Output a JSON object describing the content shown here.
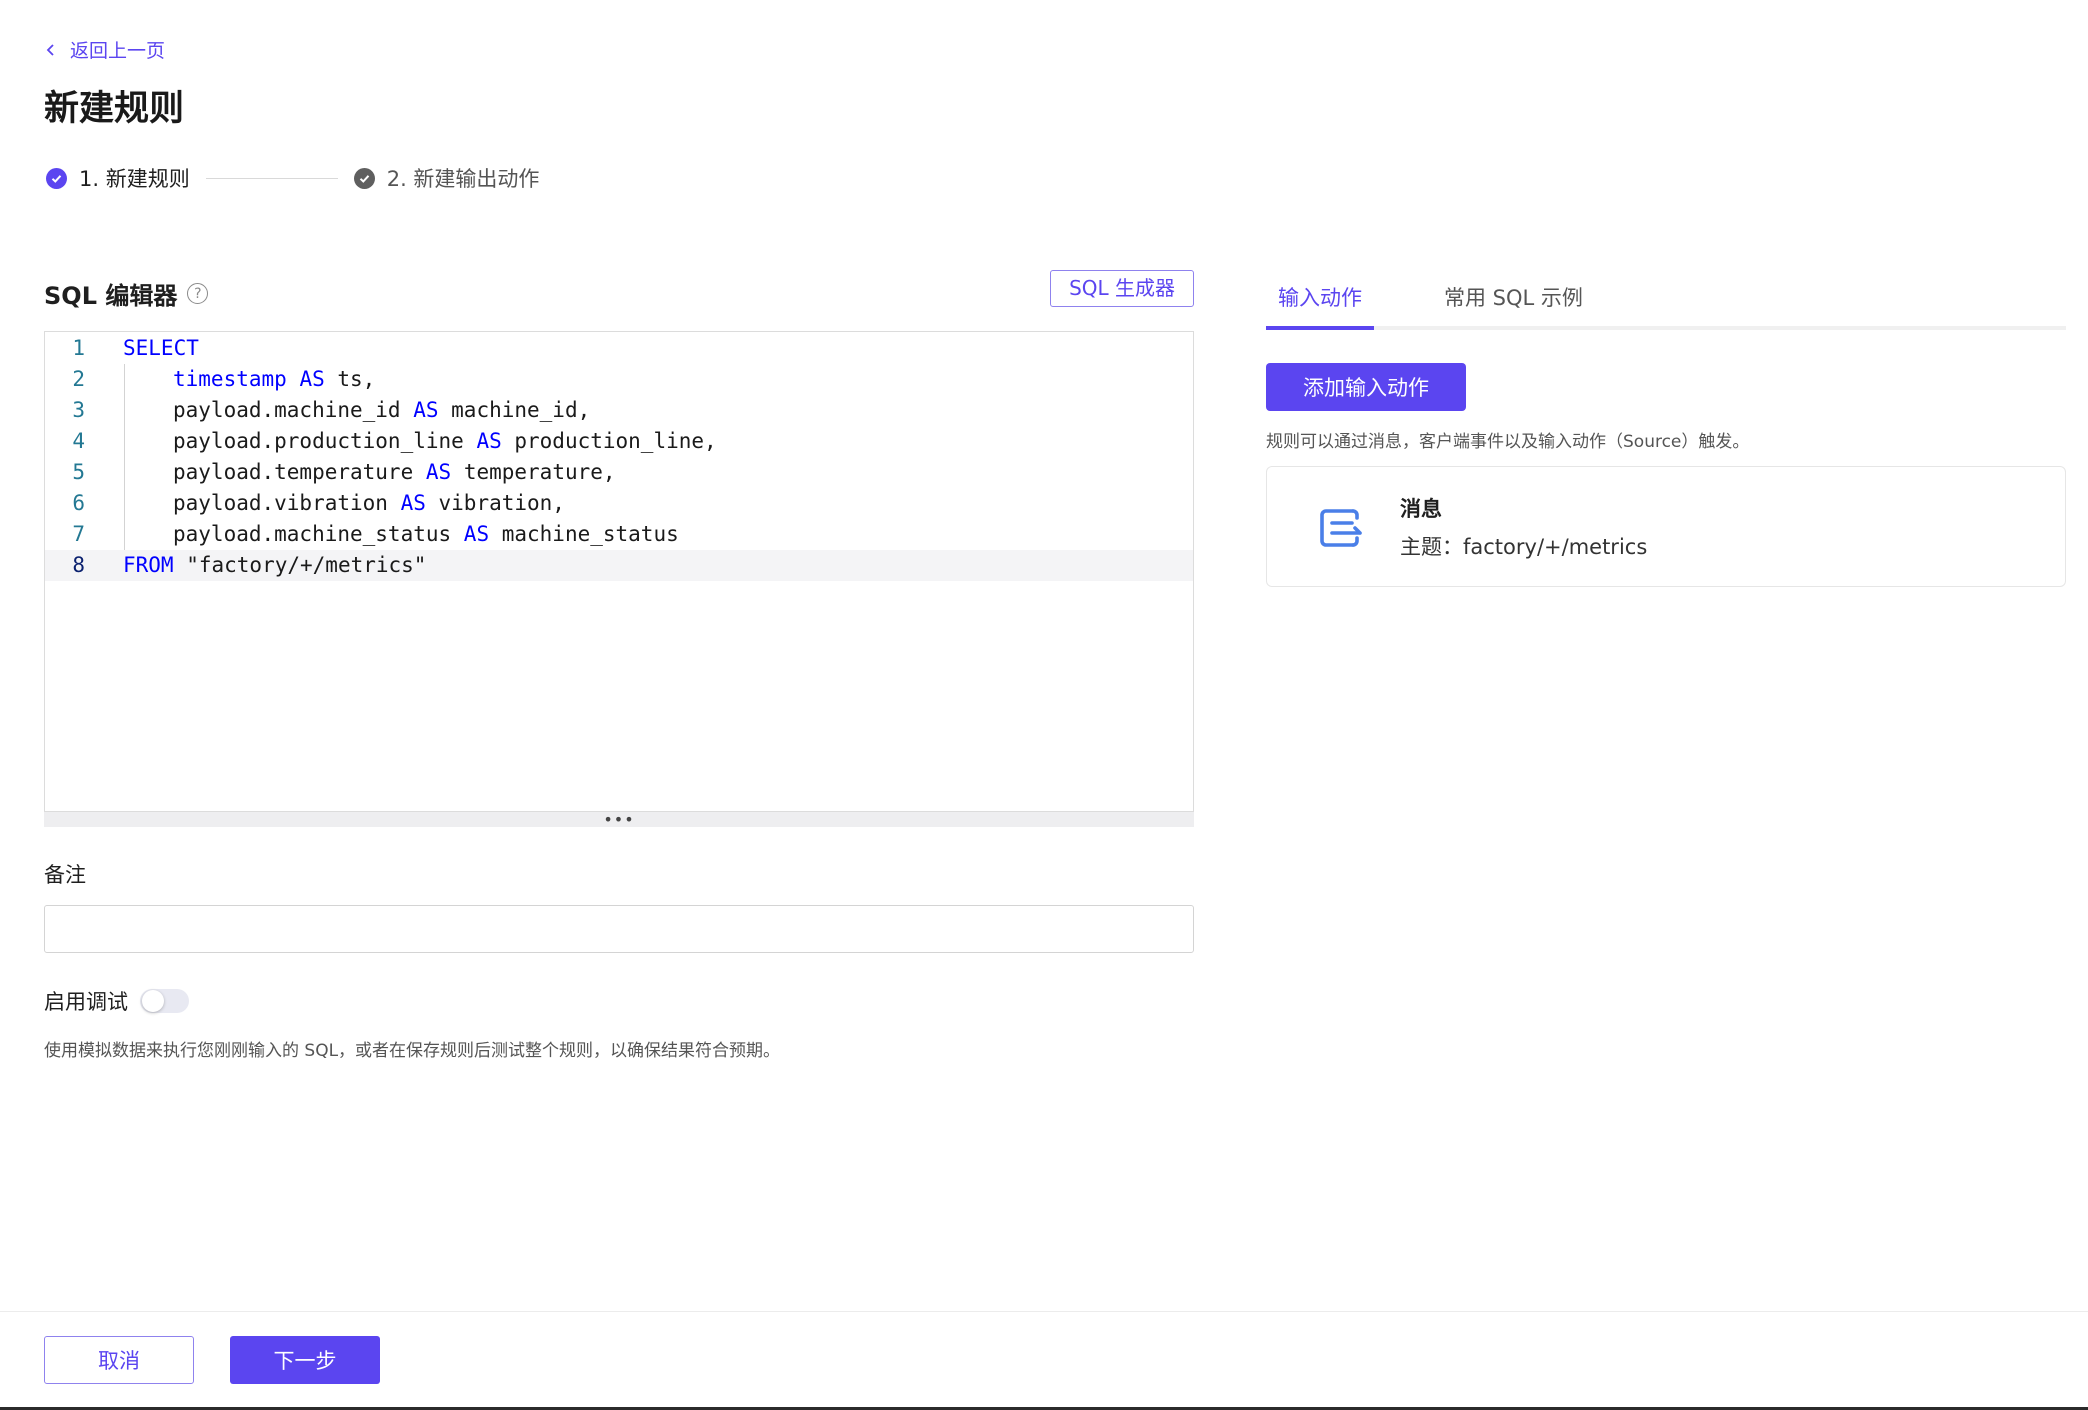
{
  "header": {
    "back_label": "返回上一页",
    "title": "新建规则"
  },
  "steps": [
    {
      "label": "1. 新建规则",
      "status": "active"
    },
    {
      "label": "2. 新建输出动作",
      "status": "pending"
    }
  ],
  "sql_editor": {
    "title": "SQL 编辑器",
    "help_icon": "?",
    "generator_button": "SQL 生成器",
    "current_line": 8,
    "lines": [
      {
        "num": "1",
        "t1": "SELECT",
        "t2": "",
        "t3": "",
        "t4": ""
      },
      {
        "num": "2",
        "t1": "timestamp",
        "t2": " ",
        "t3": "AS",
        "t4": " ts,"
      },
      {
        "num": "3",
        "t1": "payload.machine_id ",
        "t2": "",
        "t3": "AS",
        "t4": " machine_id,"
      },
      {
        "num": "4",
        "t1": "payload.production_line ",
        "t2": "",
        "t3": "AS",
        "t4": " production_line,"
      },
      {
        "num": "5",
        "t1": "payload.temperature ",
        "t2": "",
        "t3": "AS",
        "t4": " temperature,"
      },
      {
        "num": "6",
        "t1": "payload.vibration ",
        "t2": "",
        "t3": "AS",
        "t4": " vibration,"
      },
      {
        "num": "7",
        "t1": "payload.machine_status ",
        "t2": "",
        "t3": "AS",
        "t4": " machine_status"
      },
      {
        "num": "8",
        "t1": "FROM",
        "t2": " \"factory/+/metrics\"",
        "t3": "",
        "t4": ""
      }
    ]
  },
  "note": {
    "label": "备注",
    "value": ""
  },
  "debug": {
    "label": "启用调试",
    "enabled": false,
    "description": "使用模拟数据来执行您刚刚输入的 SQL，或者在保存规则后测试整个规则，以确保结果符合预期。"
  },
  "right_panel": {
    "tabs": [
      {
        "label": "输入动作",
        "active": true
      },
      {
        "label": "常用 SQL 示例",
        "active": false
      }
    ],
    "add_button": "添加输入动作",
    "description": "规则可以通过消息，客户端事件以及输入动作（Source）触发。",
    "source_card": {
      "icon": "message-source-icon",
      "title": "消息",
      "topic": "主题：factory/+/metrics"
    }
  },
  "footer": {
    "cancel_label": "取消",
    "next_label": "下一步"
  },
  "colors": {
    "accent": "#5b45f0",
    "keyword": "#0000ff",
    "line_number": "#237893",
    "icon_blue": "#4a7fe8"
  }
}
